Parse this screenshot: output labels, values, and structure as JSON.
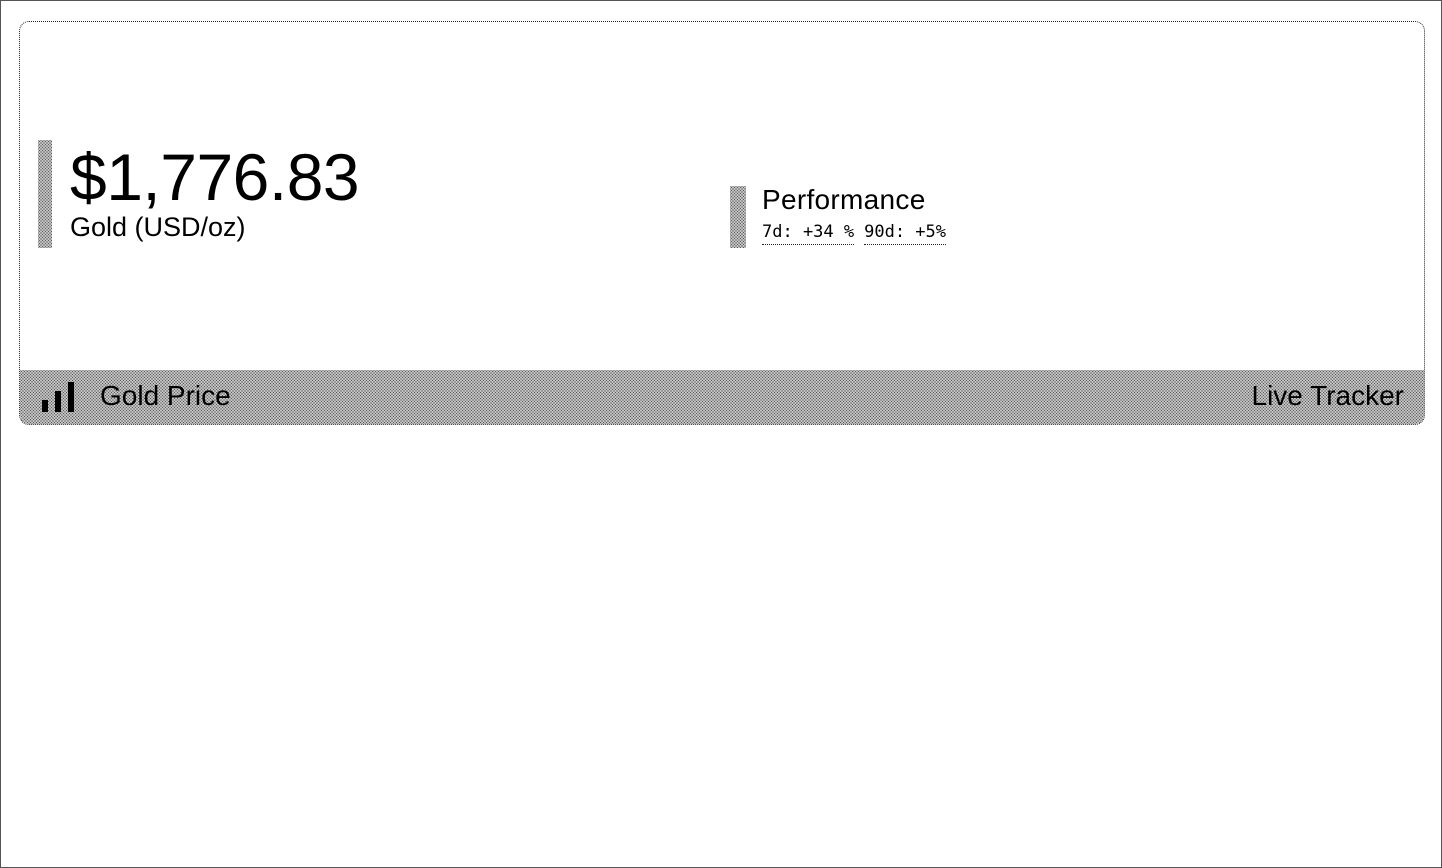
{
  "widget": {
    "price": {
      "value": "$1,776.83",
      "label": "Gold (USD/oz)"
    },
    "performance": {
      "title": "Performance",
      "stats": [
        {
          "text": "7d: +34 %"
        },
        {
          "text": "90d: +5%"
        }
      ]
    },
    "footer": {
      "icon": "bar-chart-icon",
      "title": "Gold Price",
      "tag": "Live Tracker"
    }
  },
  "colors": {
    "text": "#000000",
    "background": "#ffffff",
    "dither": "#5a5a5a",
    "border": "#222222"
  }
}
